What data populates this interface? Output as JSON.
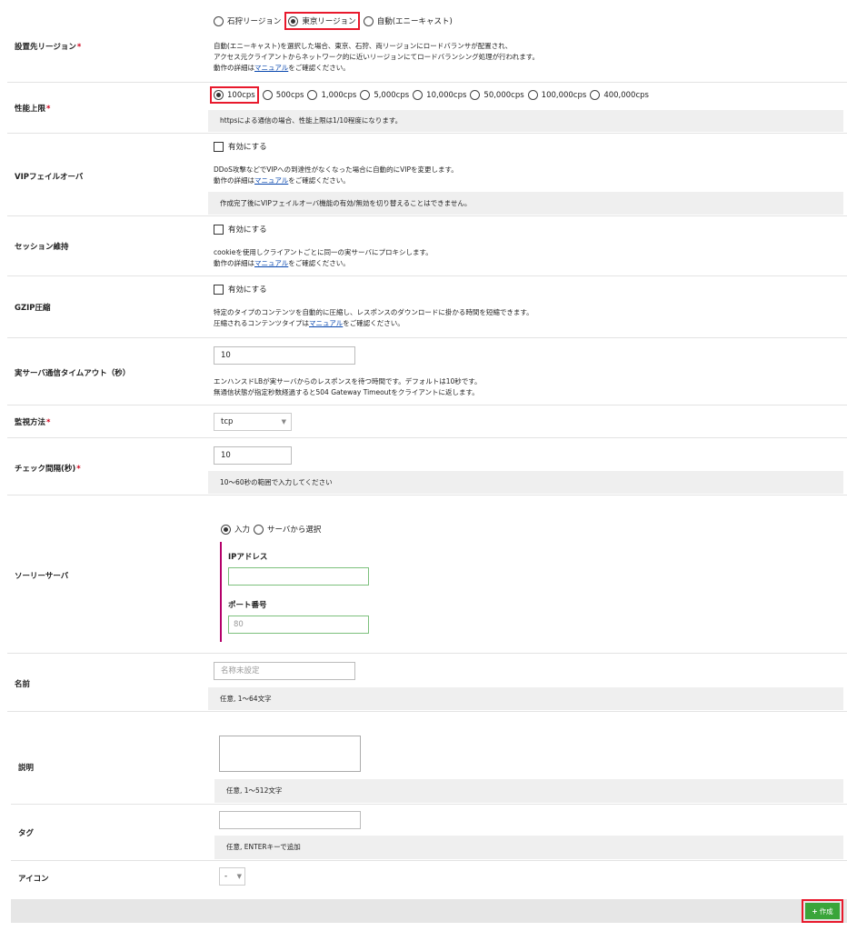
{
  "region": {
    "label": "設置先リージョン",
    "options": [
      "石狩リージョン",
      "東京リージョン",
      "自動(エニーキャスト)"
    ],
    "selected": 1,
    "help1": "自動(エニーキャスト)を選択した場合、東京、石狩、両リージョンにロードバランサが配置され、",
    "help2": "アクセス元クライアントからネットワーク的に近いリージョンにてロードバランシング処理が行われます。",
    "help3_pre": "動作の詳細は",
    "help3_link": "マニュアル",
    "help3_post": "をご確認ください。"
  },
  "performance": {
    "label": "性能上限",
    "options": [
      "100cps",
      "500cps",
      "1,000cps",
      "5,000cps",
      "10,000cps",
      "50,000cps",
      "100,000cps",
      "400,000cps"
    ],
    "selected": 0,
    "note": "httpsによる通信の場合、性能上限は1/10程度になります。"
  },
  "vip_failover": {
    "label": "VIPフェイルオーバ",
    "checkbox": "有効にする",
    "help1": "DDoS攻撃などでVIPへの到達性がなくなった場合に自動的にVIPを変更します。",
    "help2_pre": "動作の詳細は",
    "help2_link": "マニュアル",
    "help2_post": "をご確認ください。",
    "note": "作成完了後にVIPフェイルオーバ機能の有効/無効を切り替えることはできません。"
  },
  "session": {
    "label": "セッション維持",
    "checkbox": "有効にする",
    "help1": "cookieを使用しクライアントごとに同一の実サーバにプロキシします。",
    "help2_pre": "動作の詳細は",
    "help2_link": "マニュアル",
    "help2_post": "をご確認ください。"
  },
  "gzip": {
    "label": "GZIP圧縮",
    "checkbox": "有効にする",
    "help1": "特定のタイプのコンテンツを自動的に圧縮し、レスポンスのダウンロードに掛かる時間を短縮できます。",
    "help2_pre": "圧縮されるコンテンツタイプは",
    "help2_link": "マニュアル",
    "help2_post": "をご確認ください。"
  },
  "timeout": {
    "label": "実サーバ通信タイムアウト（秒）",
    "value": "10",
    "help1": "エンハンスドLBが実サーバからのレスポンスを待つ時間です。デフォルトは10秒です。",
    "help2": "無通信状態が指定秒数経過すると504 Gateway Timeoutをクライアントに返します。"
  },
  "monitor": {
    "label": "監視方法",
    "value": "tcp",
    "arrow": "▼"
  },
  "check_interval": {
    "label": "チェック間隔(秒)",
    "value": "10",
    "note": "10～60秒の範囲で入力してください"
  },
  "sorry": {
    "label": "ソーリーサーバ",
    "options": [
      "入力",
      "サーバから選択"
    ],
    "selected": 0,
    "ip_label": "IPアドレス",
    "ip_value": "",
    "port_label": "ポート番号",
    "port_placeholder": "80"
  },
  "name": {
    "label": "名前",
    "placeholder": "名称未設定",
    "note": "任意, 1～64文字"
  },
  "description": {
    "label": "説明",
    "note": "任意, 1～512文字"
  },
  "tag": {
    "label": "タグ",
    "note": "任意, ENTERキーで追加"
  },
  "icon": {
    "label": "アイコン",
    "value": "-",
    "arrow": "▼"
  },
  "footer": {
    "create_label": "作成",
    "create_icon": "+"
  },
  "colors": {
    "highlight": "#e8192c",
    "required": "#d0021b",
    "create_button": "#3aa53a",
    "link": "#0645ad",
    "sub_border": "#b4006a"
  }
}
